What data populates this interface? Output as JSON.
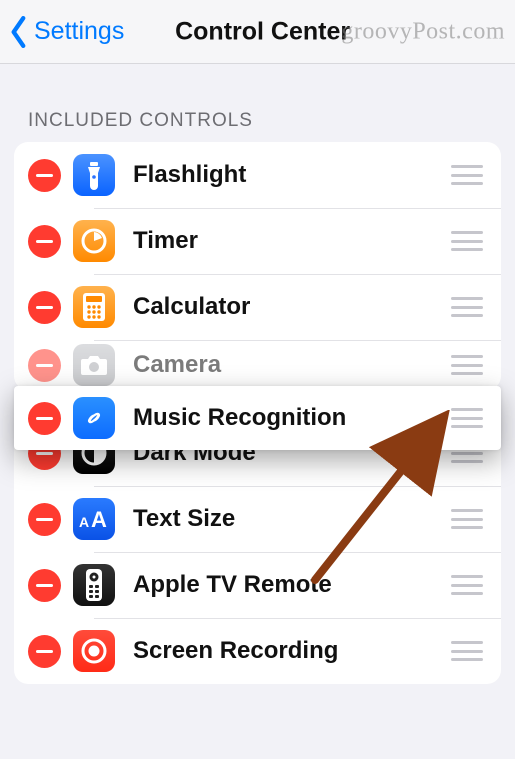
{
  "nav": {
    "back_label": "Settings",
    "title": "Control Center"
  },
  "watermark": "groovyPost.com",
  "section_header": "INCLUDED CONTROLS",
  "dragged_item": {
    "label": "Music Recognition",
    "icon": "shazam-icon"
  },
  "items_top": [
    {
      "label": "Flashlight",
      "icon": "flashlight-icon",
      "ic_class": "ic-flash"
    },
    {
      "label": "Timer",
      "icon": "timer-icon",
      "ic_class": "ic-timer"
    },
    {
      "label": "Calculator",
      "icon": "calculator-icon",
      "ic_class": "ic-calc"
    },
    {
      "label": "Camera",
      "icon": "camera-icon",
      "ic_class": "ic-cam",
      "partial": true
    }
  ],
  "items_bottom": [
    {
      "label": "Dark Mode",
      "icon": "dark-mode-icon",
      "ic_class": "ic-dark"
    },
    {
      "label": "Text Size",
      "icon": "text-size-icon",
      "ic_class": "ic-text"
    },
    {
      "label": "Apple TV Remote",
      "icon": "appletv-remote-icon",
      "ic_class": "ic-atv"
    },
    {
      "label": "Screen Recording",
      "icon": "screen-recording-icon",
      "ic_class": "ic-rec"
    }
  ]
}
